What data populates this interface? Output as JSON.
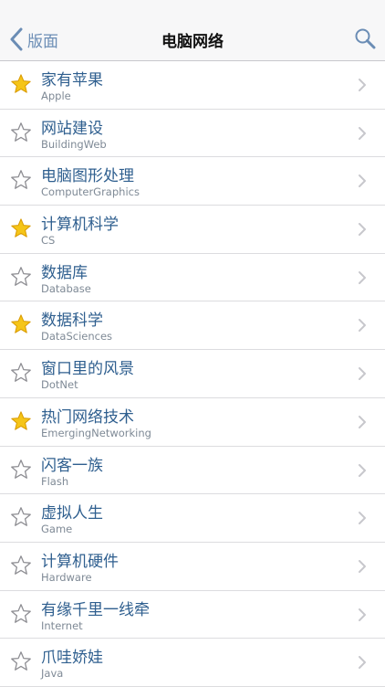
{
  "nav": {
    "back_label": "版面",
    "title": "电脑网络",
    "back_icon": "chevron-left-icon",
    "search_icon": "search-icon"
  },
  "colors": {
    "accent": "#6b8db5",
    "title_text": "#2f5f8f",
    "subtitle_text": "#7f8a96",
    "star_fill": "#f5c518"
  },
  "boards": [
    {
      "title": "家有苹果",
      "subtitle": "Apple",
      "starred": true
    },
    {
      "title": "网站建设",
      "subtitle": "BuildingWeb",
      "starred": false
    },
    {
      "title": "电脑图形处理",
      "subtitle": "ComputerGraphics",
      "starred": false
    },
    {
      "title": "计算机科学",
      "subtitle": "CS",
      "starred": true
    },
    {
      "title": "数据库",
      "subtitle": "Database",
      "starred": false
    },
    {
      "title": "数据科学",
      "subtitle": "DataSciences",
      "starred": true
    },
    {
      "title": "窗口里的风景",
      "subtitle": "DotNet",
      "starred": false
    },
    {
      "title": "热门网络技术",
      "subtitle": "EmergingNetworking",
      "starred": true
    },
    {
      "title": "闪客一族",
      "subtitle": "Flash",
      "starred": false
    },
    {
      "title": "虚拟人生",
      "subtitle": "Game",
      "starred": false
    },
    {
      "title": "计算机硬件",
      "subtitle": "Hardware",
      "starred": false
    },
    {
      "title": "有缘千里一线牵",
      "subtitle": "Internet",
      "starred": false
    },
    {
      "title": "爪哇娇娃",
      "subtitle": "Java",
      "starred": false
    }
  ]
}
